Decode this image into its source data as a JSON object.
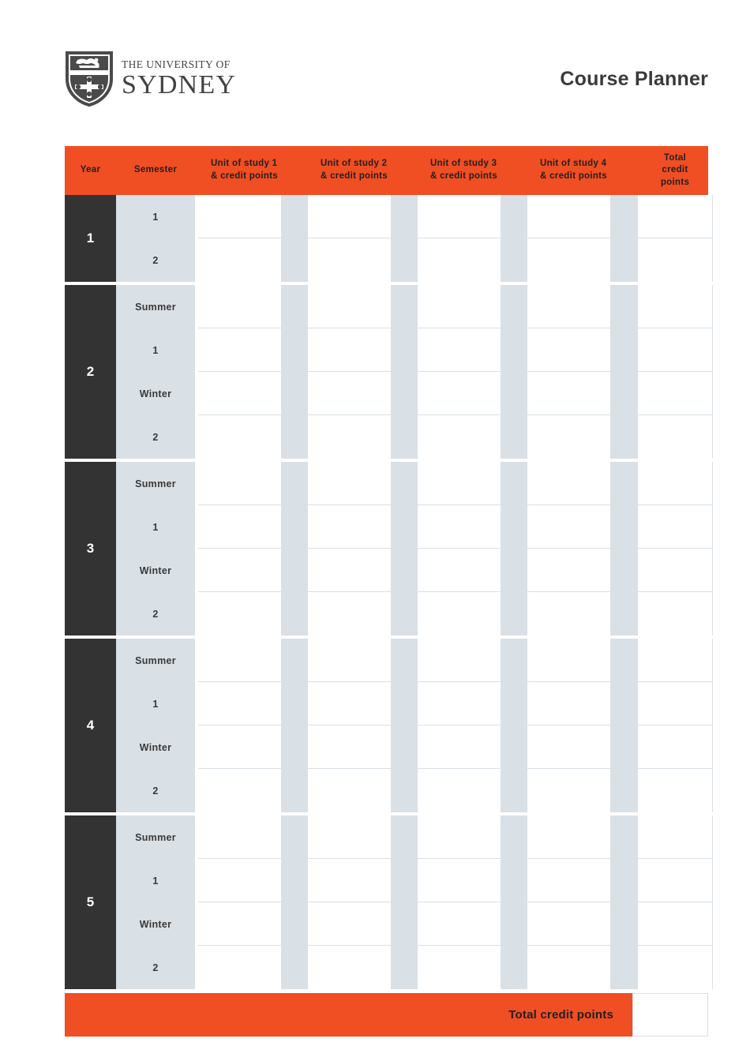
{
  "brand": {
    "crest_icon": "university-crest-icon",
    "line1": "THE UNIVERSITY OF",
    "line2": "SYDNEY"
  },
  "header": {
    "title": "Course Planner"
  },
  "colors": {
    "accent_orange": "#F04E23",
    "dark_year": "#333333",
    "light_blue_grey": "#D9E0E6",
    "text_dark": "#231f20"
  },
  "table": {
    "columns": [
      {
        "key": "year",
        "label": "Year"
      },
      {
        "key": "semester",
        "label": "Semester"
      },
      {
        "key": "unit1",
        "label": "Unit of study 1\n& credit points",
        "line1": "Unit of study 1",
        "line2": "& credit points"
      },
      {
        "key": "unit2",
        "label": "Unit of study 2\n& credit points",
        "line1": "Unit of study 2",
        "line2": "& credit points"
      },
      {
        "key": "unit3",
        "label": "Unit of study 3\n& credit points",
        "line1": "Unit of study 3",
        "line2": "& credit points"
      },
      {
        "key": "unit4",
        "label": "Unit of study 4\n& credit points",
        "line1": "Unit of study 4",
        "line2": "& credit points"
      },
      {
        "key": "total",
        "label": "Total credit points",
        "line1": "Total",
        "line2": "credit",
        "line3": "points"
      }
    ],
    "year_blocks": [
      {
        "year": "1",
        "semesters": [
          "1",
          "2"
        ],
        "rows": [
          {
            "semester": "1",
            "unit1": "",
            "unit2": "",
            "unit3": "",
            "unit4": "",
            "total": ""
          },
          {
            "semester": "2",
            "unit1": "",
            "unit2": "",
            "unit3": "",
            "unit4": "",
            "total": ""
          }
        ]
      },
      {
        "year": "2",
        "semesters": [
          "Summer",
          "1",
          "Winter",
          "2"
        ],
        "rows": [
          {
            "semester": "Summer",
            "unit1": "",
            "unit2": "",
            "unit3": "",
            "unit4": "",
            "total": ""
          },
          {
            "semester": "1",
            "unit1": "",
            "unit2": "",
            "unit3": "",
            "unit4": "",
            "total": ""
          },
          {
            "semester": "Winter",
            "unit1": "",
            "unit2": "",
            "unit3": "",
            "unit4": "",
            "total": ""
          },
          {
            "semester": "2",
            "unit1": "",
            "unit2": "",
            "unit3": "",
            "unit4": "",
            "total": ""
          }
        ]
      },
      {
        "year": "3",
        "semesters": [
          "Summer",
          "1",
          "Winter",
          "2"
        ],
        "rows": [
          {
            "semester": "Summer",
            "unit1": "",
            "unit2": "",
            "unit3": "",
            "unit4": "",
            "total": ""
          },
          {
            "semester": "1",
            "unit1": "",
            "unit2": "",
            "unit3": "",
            "unit4": "",
            "total": ""
          },
          {
            "semester": "Winter",
            "unit1": "",
            "unit2": "",
            "unit3": "",
            "unit4": "",
            "total": ""
          },
          {
            "semester": "2",
            "unit1": "",
            "unit2": "",
            "unit3": "",
            "unit4": "",
            "total": ""
          }
        ]
      },
      {
        "year": "4",
        "semesters": [
          "Summer",
          "1",
          "Winter",
          "2"
        ],
        "rows": [
          {
            "semester": "Summer",
            "unit1": "",
            "unit2": "",
            "unit3": "",
            "unit4": "",
            "total": ""
          },
          {
            "semester": "1",
            "unit1": "",
            "unit2": "",
            "unit3": "",
            "unit4": "",
            "total": ""
          },
          {
            "semester": "Winter",
            "unit1": "",
            "unit2": "",
            "unit3": "",
            "unit4": "",
            "total": ""
          },
          {
            "semester": "2",
            "unit1": "",
            "unit2": "",
            "unit3": "",
            "unit4": "",
            "total": ""
          }
        ]
      },
      {
        "year": "5",
        "semesters": [
          "Summer",
          "1",
          "Winter",
          "2"
        ],
        "rows": [
          {
            "semester": "Summer",
            "unit1": "",
            "unit2": "",
            "unit3": "",
            "unit4": "",
            "total": ""
          },
          {
            "semester": "1",
            "unit1": "",
            "unit2": "",
            "unit3": "",
            "unit4": "",
            "total": ""
          },
          {
            "semester": "Winter",
            "unit1": "",
            "unit2": "",
            "unit3": "",
            "unit4": "",
            "total": ""
          },
          {
            "semester": "2",
            "unit1": "",
            "unit2": "",
            "unit3": "",
            "unit4": "",
            "total": ""
          }
        ]
      }
    ],
    "footer": {
      "label": "Total credit points",
      "value": ""
    }
  }
}
